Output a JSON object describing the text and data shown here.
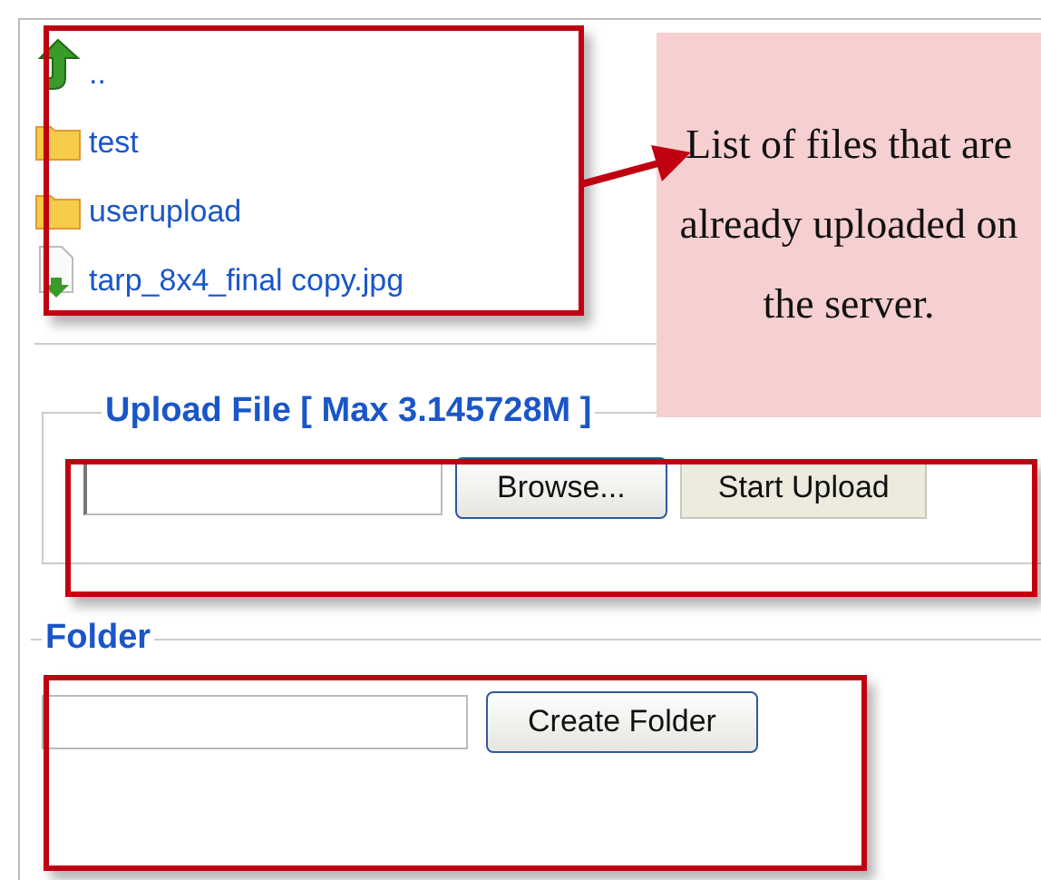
{
  "file_list": [
    {
      "kind": "parent",
      "name": ".."
    },
    {
      "kind": "folder",
      "name": "test"
    },
    {
      "kind": "folder",
      "name": "userupload"
    },
    {
      "kind": "file",
      "name": "tarp_8x4_final copy.jpg"
    }
  ],
  "callout": {
    "text": "List of files that are already uploaded on the server."
  },
  "upload": {
    "legend": "Upload File [ Max 3.145728M ]",
    "buttons": [
      "Browse...",
      "Start Upload"
    ]
  },
  "folder": {
    "legend": "Folder",
    "button": "Create Folder"
  }
}
